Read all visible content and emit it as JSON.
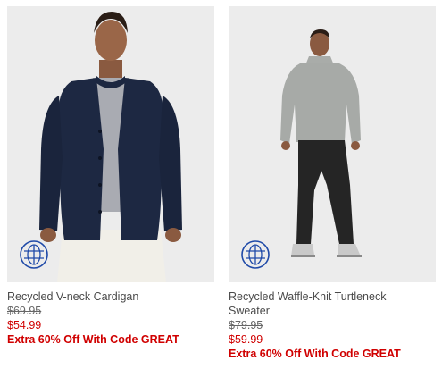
{
  "products": [
    {
      "name": "Recycled V-neck Cardigan",
      "original_price": "$69.95",
      "sale_price": "$54.99",
      "promo": "Extra 60% Off With Code GREAT",
      "badge_icon": "recycled-globe-icon"
    },
    {
      "name": "Recycled Waffle-Knit Turtleneck Sweater",
      "original_price": "$79.95",
      "sale_price": "$59.99",
      "promo": "Extra 60% Off With Code GREAT",
      "badge_icon": "recycled-globe-icon"
    }
  ],
  "colors": {
    "sale": "#d00000",
    "photo_bg": "#ebebeb",
    "badge": "#1f4aa8"
  }
}
